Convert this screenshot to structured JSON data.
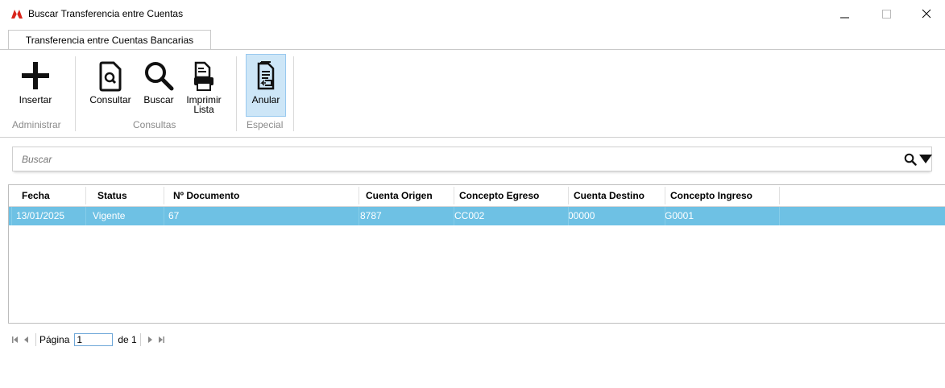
{
  "window": {
    "title": "Buscar Transferencia entre Cuentas",
    "minimize_glyph": "—",
    "maximize_glyph": "☐",
    "close_glyph": "✕"
  },
  "ribbon": {
    "tab_label": "Transferencia entre Cuentas Bancarias",
    "groups": {
      "administrar": "Administrar",
      "consultas": "Consultas",
      "especial": "Especial"
    },
    "buttons": {
      "insertar": "Insertar",
      "consultar": "Consultar",
      "buscar": "Buscar",
      "imprimir_line1": "Imprimir",
      "imprimir_line2": "Lista",
      "anular": "Anular"
    },
    "icons": {
      "insertar": "plus-icon",
      "consultar": "document-search-icon",
      "buscar": "magnifier-icon",
      "imprimir": "print-document-icon",
      "anular": "document-cancel-icon"
    }
  },
  "search": {
    "placeholder": "Buscar",
    "value": ""
  },
  "grid": {
    "columns": [
      "Fecha",
      "Status",
      "Nº Documento",
      "Cuenta Origen",
      "Concepto Egreso",
      "Cuenta Destino",
      "Concepto Ingreso"
    ],
    "rows": [
      [
        "13/01/2025",
        "Vigente",
        "67",
        "8787",
        "CC002",
        "00000",
        "G0001"
      ]
    ],
    "selected_row_color": "#6ec1e4"
  },
  "pager": {
    "page_label": "Página",
    "page_value": "1",
    "of_label": "de 1"
  },
  "colors": {
    "accent": "#6ec1e4",
    "anular_button_bg": "#cde6f7",
    "anular_button_border": "#99c9ef"
  }
}
